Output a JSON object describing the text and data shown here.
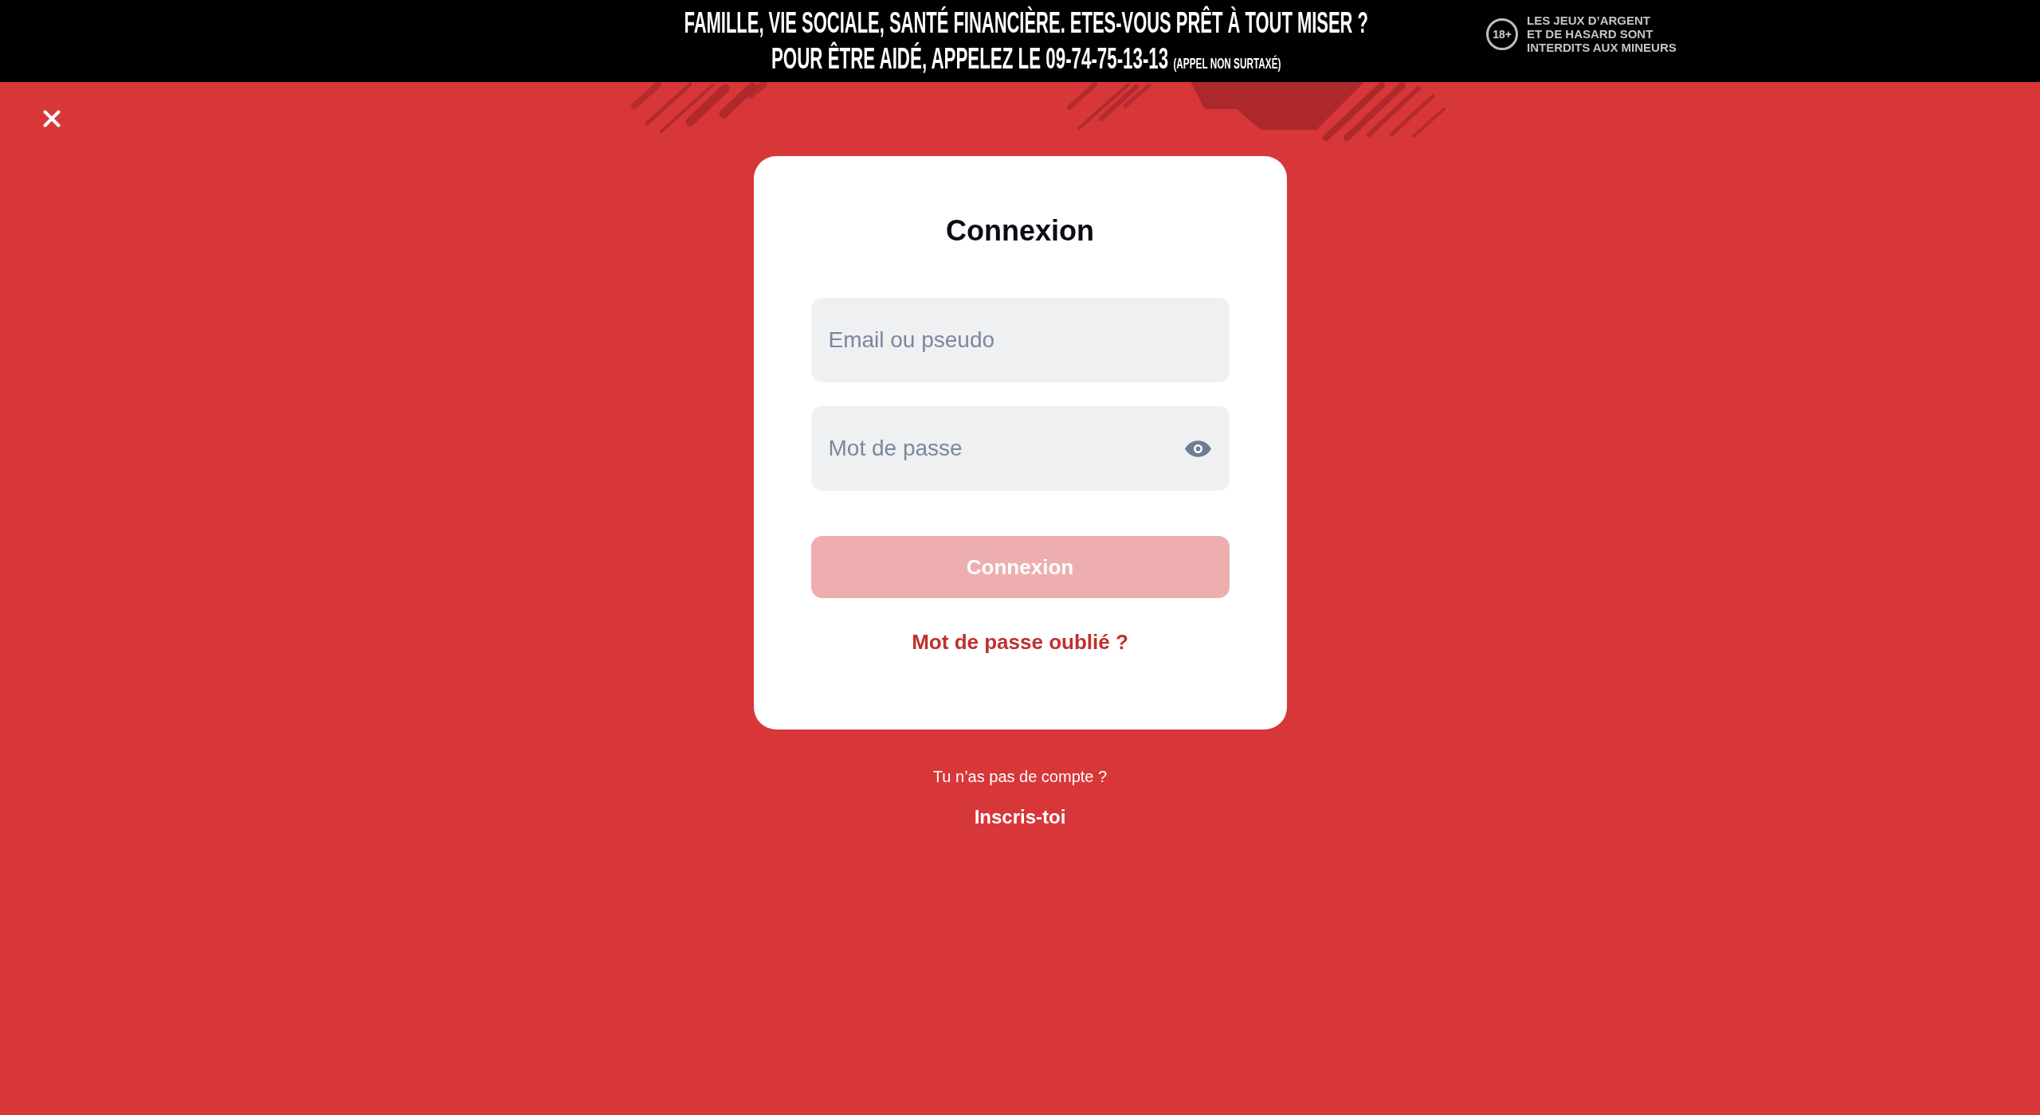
{
  "banner": {
    "headline": "FAMILLE, VIE SOCIALE, SANTÉ FINANCIÈRE. ETES-VOUS PRÊT À TOUT MISER ?",
    "helpline": "POUR ÊTRE AIDÉ, APPELEZ LE 09-74-75-13-13",
    "helpline_note": "(APPEL NON SURTAXÉ)",
    "age_mark": "18+",
    "age_warning": [
      "LES JEUX D’ARGENT",
      "ET DE HASARD SONT",
      "INTERDITS AUX MINEURS"
    ]
  },
  "login_card": {
    "title": "Connexion",
    "fields": [
      {
        "kind": "text",
        "placeholder": "Email ou pseudo"
      },
      {
        "kind": "password",
        "placeholder": "Mot de passe"
      }
    ],
    "submit_button": {
      "label": "Connexion",
      "disabled": true
    },
    "forgot_password_link": "Mot de passe oublié ?"
  },
  "signup": {
    "prompt": "Tu n’as pas de compte ?",
    "link": "Inscris-toi"
  }
}
